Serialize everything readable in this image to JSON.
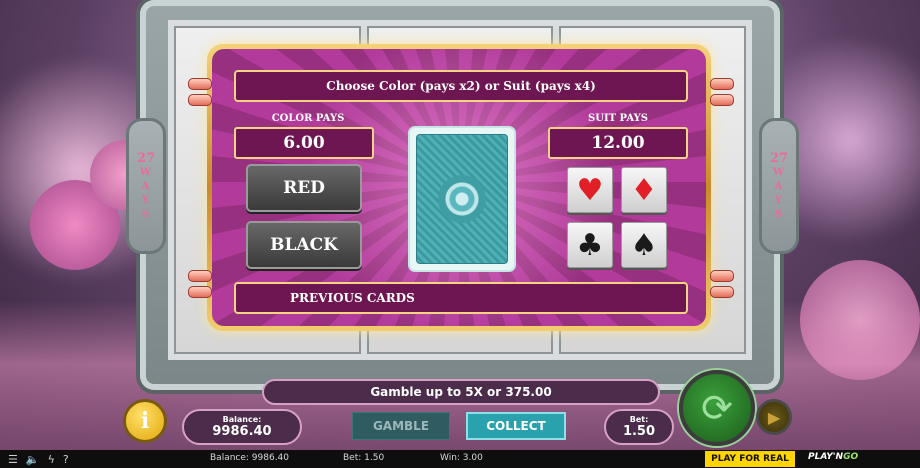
{
  "gamble": {
    "title": "Choose Color (pays x2) or Suit (pays x4)",
    "color_pays_label": "COLOR PAYS",
    "color_pays_value": "6.00",
    "suit_pays_label": "SUIT PAYS",
    "suit_pays_value": "12.00",
    "red_label": "RED",
    "black_label": "BLACK",
    "previous_cards_label": "PREVIOUS CARDS",
    "suits": [
      {
        "symbol": "♥",
        "name": "hearts",
        "color": "#e01f26"
      },
      {
        "symbol": "♦",
        "name": "diamonds",
        "color": "#e01f26"
      },
      {
        "symbol": "♣",
        "name": "clubs",
        "color": "#1a1a1a"
      },
      {
        "symbol": "♠",
        "name": "spades",
        "color": "#1a1a1a"
      }
    ],
    "card_back_icon": "card-back"
  },
  "ways": {
    "count": "27",
    "letters": [
      "W",
      "A",
      "Y",
      "S"
    ]
  },
  "hud": {
    "info_text": "Gamble up to 5X or 375.00",
    "info_icon": "i",
    "balance_label": "Balance:",
    "balance_value": "9986.40",
    "gamble_label": "GAMBLE",
    "collect_label": "COLLECT",
    "bet_label": "Bet:",
    "bet_value": "1.50",
    "spin_icon": "spin-arrows",
    "autoplay_icon": "play"
  },
  "footer": {
    "balance": "Balance: 9986.40",
    "bet": "Bet: 1.50",
    "win": "Win: 3.00",
    "play_for_real": "PLAY FOR REAL",
    "logo_play": "PLAY'N",
    "logo_go": "GO"
  },
  "colors": {
    "panel_purple": "#6d1651",
    "gold": "#f3d486",
    "collect": "#2aa2ad",
    "pfr_yellow": "#ffd400"
  }
}
